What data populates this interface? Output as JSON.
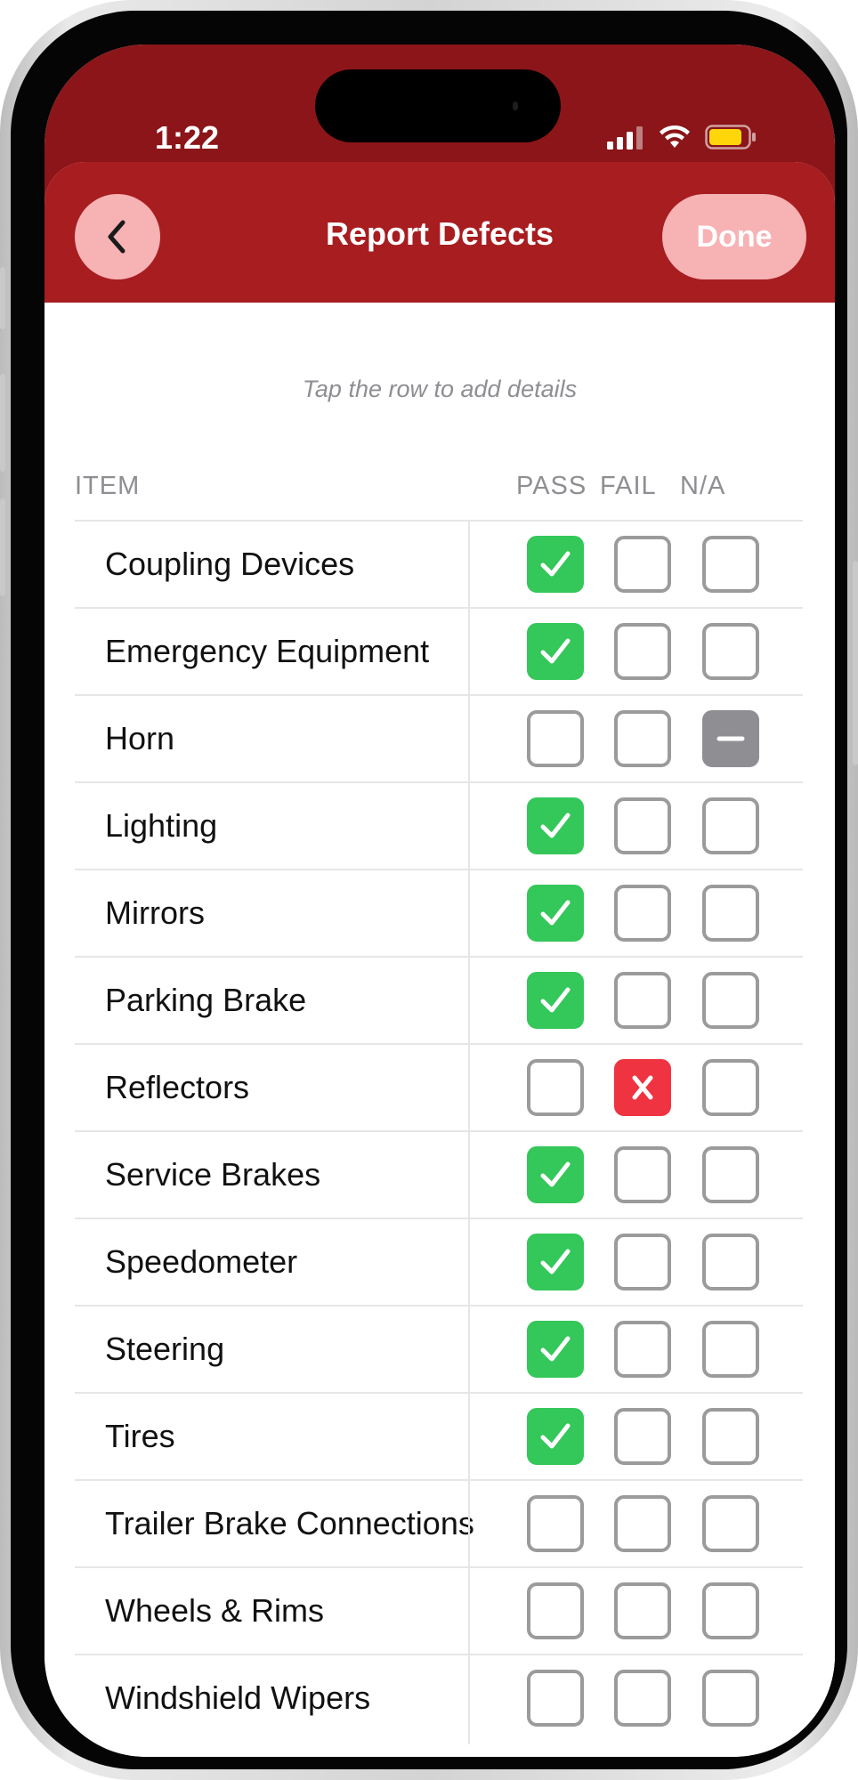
{
  "status_bar": {
    "time": "1:22"
  },
  "nav": {
    "title": "Report Defects",
    "done_label": "Done",
    "back_icon": "chevron-left-icon"
  },
  "hint": "Tap the row to add details",
  "table": {
    "headers": {
      "item": "ITEM",
      "pass": "PASS",
      "fail": "FAIL",
      "na": "N/A"
    },
    "rows": [
      {
        "label": "Coupling Devices",
        "status": "pass"
      },
      {
        "label": "Emergency Equipment",
        "status": "pass"
      },
      {
        "label": "Horn",
        "status": "na"
      },
      {
        "label": "Lighting",
        "status": "pass"
      },
      {
        "label": "Mirrors",
        "status": "pass"
      },
      {
        "label": "Parking Brake",
        "status": "pass"
      },
      {
        "label": "Reflectors",
        "status": "fail"
      },
      {
        "label": "Service Brakes",
        "status": "pass"
      },
      {
        "label": "Speedometer",
        "status": "pass"
      },
      {
        "label": "Steering",
        "status": "pass"
      },
      {
        "label": "Tires",
        "status": "pass"
      },
      {
        "label": "Trailer Brake Connections",
        "status": ""
      },
      {
        "label": "Wheels & Rims",
        "status": ""
      },
      {
        "label": "Windshield Wipers",
        "status": ""
      }
    ]
  },
  "colors": {
    "status_bar": "#8b1518",
    "nav_bar": "#a71d20",
    "button_tint": "#f7b2b4",
    "pass": "#34c759",
    "fail": "#ef3340",
    "na": "#8e8e93",
    "unchecked_border": "#9b9b9b"
  }
}
